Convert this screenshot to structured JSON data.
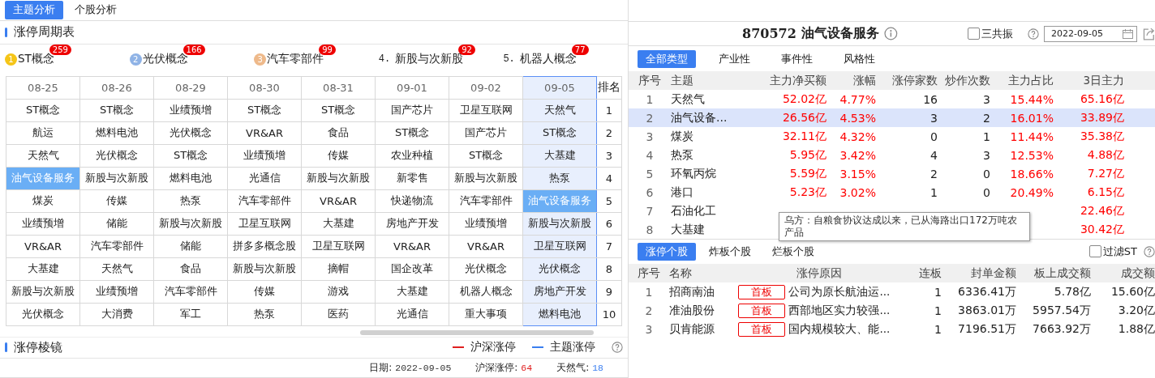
{
  "main_tabs": [
    {
      "label": "主题分析",
      "selected": true
    },
    {
      "label": "个股分析",
      "selected": false
    }
  ],
  "cycle_table": {
    "title": "涨停周期表",
    "ranking": [
      {
        "kind": "medal",
        "rank": "1",
        "color": "#f5c518",
        "name": "ST概念",
        "count": "259"
      },
      {
        "kind": "medal",
        "rank": "2",
        "color": "#8fb3e6",
        "name": "光伏概念",
        "count": "166"
      },
      {
        "kind": "medal",
        "rank": "3",
        "color": "#eeb98a",
        "name": "汽车零部件",
        "count": "99"
      },
      {
        "kind": "plain",
        "rank": "4.",
        "name": "新股与次新股",
        "count": "92"
      },
      {
        "kind": "plain",
        "rank": "5.",
        "name": "机器人概念",
        "count": "77"
      }
    ],
    "columns": [
      {
        "date": "08-25",
        "selected": false
      },
      {
        "date": "08-26",
        "selected": false
      },
      {
        "date": "08-29",
        "selected": false
      },
      {
        "date": "08-30",
        "selected": false
      },
      {
        "date": "08-31",
        "selected": false
      },
      {
        "date": "09-01",
        "selected": false
      },
      {
        "date": "09-02",
        "selected": false
      },
      {
        "date": "09-05",
        "selected": true
      }
    ],
    "rank_header": "排名",
    "rows": [
      {
        "rank": "1",
        "cells": [
          {
            "text": "ST概念",
            "highlighted": false
          },
          {
            "text": "ST概念",
            "highlighted": false
          },
          {
            "text": "业绩预增",
            "highlighted": false
          },
          {
            "text": "ST概念",
            "highlighted": false
          },
          {
            "text": "ST概念",
            "highlighted": false
          },
          {
            "text": "国产芯片",
            "highlighted": false
          },
          {
            "text": "卫星互联网",
            "highlighted": false
          },
          {
            "text": "天然气",
            "highlighted": false
          }
        ]
      },
      {
        "rank": "2",
        "cells": [
          {
            "text": "航运",
            "highlighted": false
          },
          {
            "text": "燃料电池",
            "highlighted": false
          },
          {
            "text": "光伏概念",
            "highlighted": false
          },
          {
            "text": "VR&AR",
            "highlighted": false
          },
          {
            "text": "食品",
            "highlighted": false
          },
          {
            "text": "ST概念",
            "highlighted": false
          },
          {
            "text": "国产芯片",
            "highlighted": false
          },
          {
            "text": "ST概念",
            "highlighted": false
          }
        ]
      },
      {
        "rank": "3",
        "cells": [
          {
            "text": "天然气",
            "highlighted": false
          },
          {
            "text": "光伏概念",
            "highlighted": false
          },
          {
            "text": "ST概念",
            "highlighted": false
          },
          {
            "text": "业绩预增",
            "highlighted": false
          },
          {
            "text": "传媒",
            "highlighted": false
          },
          {
            "text": "农业种植",
            "highlighted": false
          },
          {
            "text": "ST概念",
            "highlighted": false
          },
          {
            "text": "大基建",
            "highlighted": false
          }
        ]
      },
      {
        "rank": "4",
        "cells": [
          {
            "text": "油气设备服务",
            "highlighted": true
          },
          {
            "text": "新股与次新股",
            "highlighted": false
          },
          {
            "text": "燃料电池",
            "highlighted": false
          },
          {
            "text": "光通信",
            "highlighted": false
          },
          {
            "text": "新股与次新股",
            "highlighted": false
          },
          {
            "text": "新零售",
            "highlighted": false
          },
          {
            "text": "新股与次新股",
            "highlighted": false
          },
          {
            "text": "热泵",
            "highlighted": false
          }
        ]
      },
      {
        "rank": "5",
        "cells": [
          {
            "text": "煤炭",
            "highlighted": false
          },
          {
            "text": "传媒",
            "highlighted": false
          },
          {
            "text": "热泵",
            "highlighted": false
          },
          {
            "text": "汽车零部件",
            "highlighted": false
          },
          {
            "text": "VR&AR",
            "highlighted": false
          },
          {
            "text": "快递物流",
            "highlighted": false
          },
          {
            "text": "汽车零部件",
            "highlighted": false
          },
          {
            "text": "油气设备服务",
            "highlighted": true
          }
        ]
      },
      {
        "rank": "6",
        "cells": [
          {
            "text": "业绩预增",
            "highlighted": false
          },
          {
            "text": "储能",
            "highlighted": false
          },
          {
            "text": "新股与次新股",
            "highlighted": false
          },
          {
            "text": "卫星互联网",
            "highlighted": false
          },
          {
            "text": "大基建",
            "highlighted": false
          },
          {
            "text": "房地产开发",
            "highlighted": false
          },
          {
            "text": "业绩预增",
            "highlighted": false
          },
          {
            "text": "新股与次新股",
            "highlighted": false
          }
        ]
      },
      {
        "rank": "7",
        "cells": [
          {
            "text": "VR&AR",
            "highlighted": false
          },
          {
            "text": "汽车零部件",
            "highlighted": false
          },
          {
            "text": "储能",
            "highlighted": false
          },
          {
            "text": "拼多多概念股",
            "highlighted": false
          },
          {
            "text": "卫星互联网",
            "highlighted": false
          },
          {
            "text": "VR&AR",
            "highlighted": false
          },
          {
            "text": "VR&AR",
            "highlighted": false
          },
          {
            "text": "卫星互联网",
            "highlighted": false
          }
        ]
      },
      {
        "rank": "8",
        "cells": [
          {
            "text": "大基建",
            "highlighted": false
          },
          {
            "text": "天然气",
            "highlighted": false
          },
          {
            "text": "食品",
            "highlighted": false
          },
          {
            "text": "新股与次新股",
            "highlighted": false
          },
          {
            "text": "摘帽",
            "highlighted": false
          },
          {
            "text": "国企改革",
            "highlighted": false
          },
          {
            "text": "光伏概念",
            "highlighted": false
          },
          {
            "text": "光伏概念",
            "highlighted": false
          }
        ]
      },
      {
        "rank": "9",
        "cells": [
          {
            "text": "新股与次新股",
            "highlighted": false
          },
          {
            "text": "业绩预增",
            "highlighted": false
          },
          {
            "text": "汽车零部件",
            "highlighted": false
          },
          {
            "text": "传媒",
            "highlighted": false
          },
          {
            "text": "游戏",
            "highlighted": false
          },
          {
            "text": "大基建",
            "highlighted": false
          },
          {
            "text": "机器人概念",
            "highlighted": false
          },
          {
            "text": "房地产开发",
            "highlighted": false
          }
        ]
      },
      {
        "rank": "10",
        "cells": [
          {
            "text": "光伏概念",
            "highlighted": false
          },
          {
            "text": "大消费",
            "highlighted": false
          },
          {
            "text": "军工",
            "highlighted": false
          },
          {
            "text": "热泵",
            "highlighted": false
          },
          {
            "text": "医药",
            "highlighted": false
          },
          {
            "text": "光通信",
            "highlighted": false
          },
          {
            "text": "重大事项",
            "highlighted": false
          },
          {
            "text": "燃料电池",
            "highlighted": false
          }
        ]
      }
    ]
  },
  "prism": {
    "title": "涨停棱镜",
    "legend": [
      {
        "label": "沪深涨停",
        "color": "#e02020"
      },
      {
        "label": "主题涨停",
        "color": "#3a7ef0"
      }
    ],
    "info": [
      {
        "label": "日期:",
        "value": "2022-09-05",
        "color": "#333333"
      },
      {
        "label": "沪深涨停:",
        "value": "64",
        "color": "#e02020"
      },
      {
        "label": "天然气:",
        "value": "18",
        "color": "#3a7ef0"
      }
    ]
  },
  "detail": {
    "code": "870572",
    "name": "油气设备服务",
    "resonance": {
      "label": "三共振",
      "checked": false
    },
    "date": "2022-09-05",
    "type_tabs": [
      {
        "label": "全部类型",
        "selected": true
      },
      {
        "label": "产业性",
        "selected": false
      },
      {
        "label": "事件性",
        "selected": false
      },
      {
        "label": "风格性",
        "selected": false
      }
    ],
    "columns": [
      "序号",
      "主题",
      "主力净买额",
      "涨幅",
      "涨停家数",
      "炒作次数",
      "主力占比",
      "3日主力"
    ],
    "rows": [
      {
        "no": "1",
        "theme": "天然气",
        "net_buy": "52.02亿",
        "change": "4.77%",
        "limit_up": "16",
        "times": "3",
        "share": "15.44%",
        "three_day": "65.16亿",
        "selected": false
      },
      {
        "no": "2",
        "theme": "油气设备...",
        "net_buy": "26.56亿",
        "change": "4.53%",
        "limit_up": "3",
        "times": "2",
        "share": "16.01%",
        "three_day": "33.89亿",
        "selected": true
      },
      {
        "no": "3",
        "theme": "煤炭",
        "net_buy": "32.11亿",
        "change": "4.32%",
        "limit_up": "0",
        "times": "1",
        "share": "11.44%",
        "three_day": "35.38亿",
        "selected": false
      },
      {
        "no": "4",
        "theme": "热泵",
        "net_buy": "5.95亿",
        "change": "3.42%",
        "limit_up": "4",
        "times": "3",
        "share": "12.53%",
        "three_day": "4.88亿",
        "selected": false
      },
      {
        "no": "5",
        "theme": "环氧丙烷",
        "net_buy": "5.59亿",
        "change": "3.15%",
        "limit_up": "2",
        "times": "0",
        "share": "18.66%",
        "three_day": "7.27亿",
        "selected": false
      },
      {
        "no": "6",
        "theme": "港口",
        "net_buy": "5.23亿",
        "change": "3.02%",
        "limit_up": "1",
        "times": "0",
        "share": "20.49%",
        "three_day": "6.15亿",
        "selected": false
      },
      {
        "no": "7",
        "theme": "石油化工",
        "three_day": "22.46亿",
        "selected": false
      },
      {
        "no": "8",
        "theme": "大基建",
        "three_day": "30.42亿",
        "selected": false
      }
    ],
    "tooltip": "乌方：自粮食协议达成以来，已从海路出口172万吨农产品",
    "stock_tabs": [
      {
        "label": "涨停个股",
        "selected": true
      },
      {
        "label": "炸板个股",
        "selected": false
      },
      {
        "label": "烂板个股",
        "selected": false
      }
    ],
    "filter_st": {
      "label": "过滤ST",
      "checked": false
    },
    "stock_columns": [
      "序号",
      "名称",
      "涨停原因",
      "连板",
      "封单金额",
      "板上成交额",
      "成交额"
    ],
    "stocks": [
      {
        "no": "1",
        "name": "招商南油",
        "tag": "首板",
        "reason": "公司为原长航油运...",
        "boards": "1",
        "seal": "6336.41万",
        "on_board": "5.78亿",
        "turnover": "15.60亿"
      },
      {
        "no": "2",
        "name": "准油股份",
        "tag": "首板",
        "reason": "西部地区实力较强...",
        "boards": "1",
        "seal": "3863.01万",
        "on_board": "5957.54万",
        "turnover": "3.20亿"
      },
      {
        "no": "3",
        "name": "贝肯能源",
        "tag": "首板",
        "reason": "国内规模较大、能...",
        "boards": "1",
        "seal": "7196.51万",
        "on_board": "7663.92万",
        "turnover": "1.88亿"
      }
    ]
  }
}
